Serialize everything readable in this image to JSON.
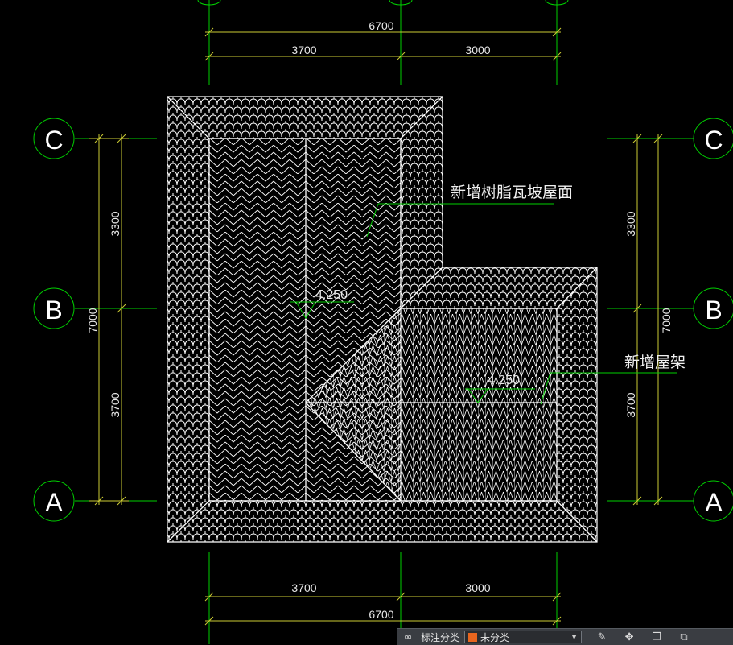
{
  "drawing": {
    "dimensions": {
      "top_total": "6700",
      "top_left": "3700",
      "top_right": "3000",
      "bottom_left": "3700",
      "bottom_right": "3000",
      "bottom_total": "6700",
      "left_total": "7000",
      "left_upper": "3300",
      "left_lower": "3700",
      "right_total": "7000",
      "right_upper": "3300",
      "right_lower": "3700"
    },
    "axes": {
      "left": [
        "C",
        "B",
        "A"
      ],
      "right": [
        "C",
        "B",
        "A"
      ]
    },
    "annotations": {
      "roof_surface": "新增树脂瓦坡屋面",
      "roof_truss": "新增屋架",
      "elevation_1": "4.250",
      "elevation_2": "4.250"
    },
    "colors": {
      "background": "#000000",
      "grid": "#00ff00",
      "dimension": "#cccc33",
      "tiles": "#ffffff",
      "text": "#e8e8e8"
    }
  },
  "toolbar": {
    "label": "标注分类",
    "select_value": "未分类",
    "swatch_color": "#e8651e",
    "icons": [
      "infinity-icon",
      "edit-icon",
      "move-icon",
      "copy-icon",
      "layers-icon"
    ]
  }
}
